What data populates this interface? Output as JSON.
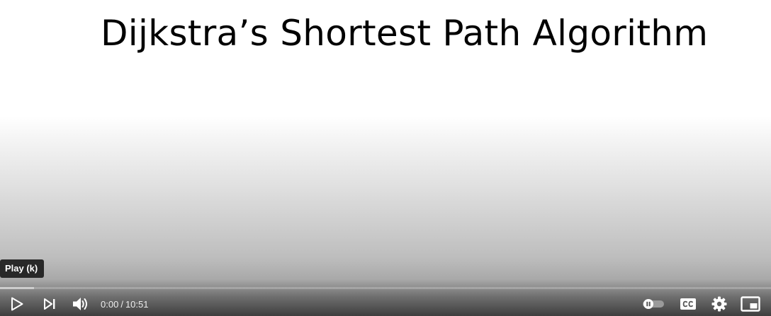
{
  "video": {
    "slide_title": "Dijkstra’s Shortest Path Algorithm",
    "progress_played": 0.0,
    "progress_buffered": 0.044
  },
  "tooltip": {
    "text": "Play (k)"
  },
  "controls": {
    "current_time": "0:00",
    "separator": "/",
    "duration": "10:51",
    "icons": {
      "play": "play-icon",
      "next": "next-icon",
      "volume": "volume-icon",
      "autoplay": "autoplay-toggle-icon",
      "captions": "cc-icon",
      "settings": "gear-icon",
      "miniplayer": "miniplayer-icon"
    },
    "autoplay_on": false
  },
  "colors": {
    "icon": "#ffffff",
    "progress_played": "#ff0000",
    "tooltip_bg": "#1c1c1c"
  }
}
